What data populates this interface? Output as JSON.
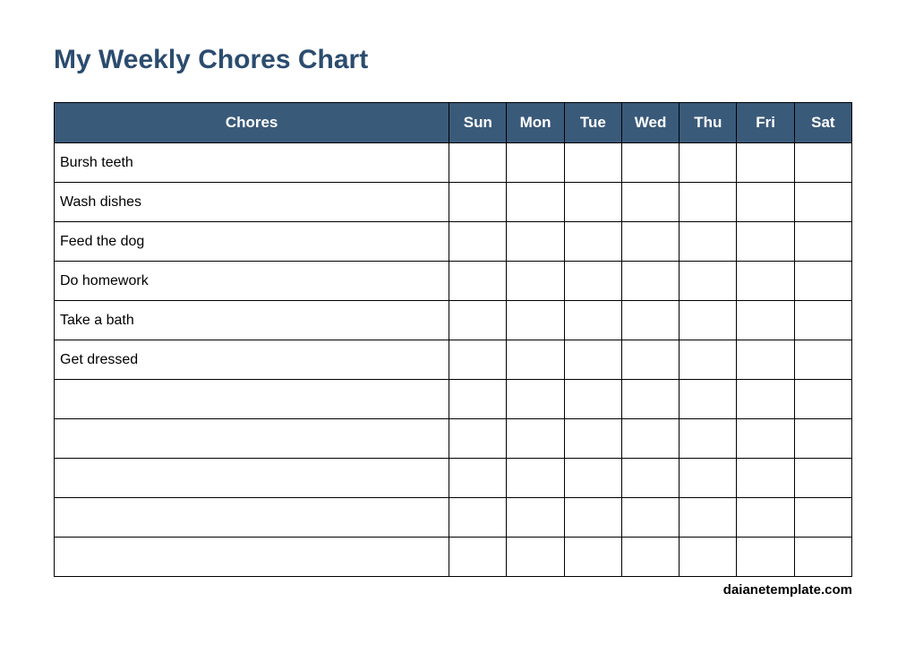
{
  "title": "My Weekly Chores Chart",
  "headers": {
    "chores": "Chores",
    "days": [
      "Sun",
      "Mon",
      "Tue",
      "Wed",
      "Thu",
      "Fri",
      "Sat"
    ]
  },
  "rows": [
    "Bursh teeth",
    "Wash dishes",
    "Feed the dog",
    "Do homework",
    "Take a bath",
    "Get dressed",
    "",
    "",
    "",
    "",
    ""
  ],
  "footer": "daianetemplate.com",
  "colors": {
    "header_bg": "#3a5a7a",
    "title_color": "#2b4c6f"
  }
}
